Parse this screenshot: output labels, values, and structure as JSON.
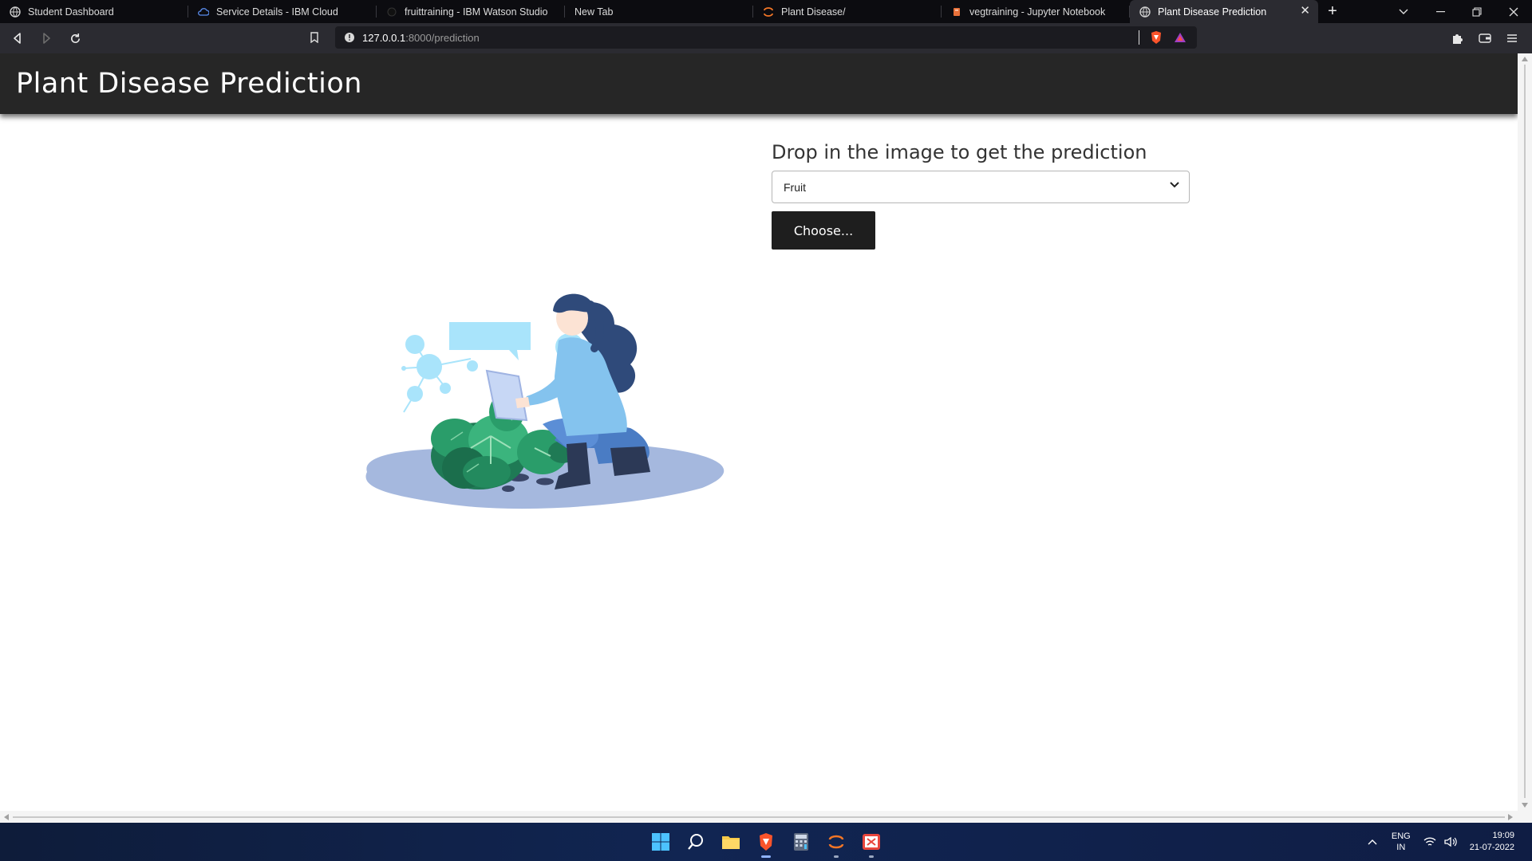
{
  "browser": {
    "tabs": [
      {
        "title": "Student Dashboard",
        "icon": "globe-icon",
        "active": false
      },
      {
        "title": "Service Details - IBM Cloud",
        "icon": "cloud-icon",
        "active": false
      },
      {
        "title": "fruittraining - IBM Watson Studio",
        "icon": "watson-icon",
        "active": false
      },
      {
        "title": "New Tab",
        "icon": "",
        "active": false
      },
      {
        "title": "Plant Disease/",
        "icon": "jupyter-icon",
        "active": false
      },
      {
        "title": "vegtraining - Jupyter Notebook",
        "icon": "notebook-icon",
        "active": false
      },
      {
        "title": "Plant Disease Prediction",
        "icon": "globe-icon",
        "active": true
      }
    ],
    "url_host": "127.0.0.1",
    "url_path": ":8000/prediction"
  },
  "page": {
    "title": "Plant Disease Prediction",
    "heading": "Drop in the image to get the prediction",
    "select_value": "Fruit",
    "choose_label": "Choose..."
  },
  "taskbar": {
    "lang_line1": "ENG",
    "lang_line2": "IN",
    "time": "19:09",
    "date": "21-07-2022"
  },
  "colors": {
    "header_bg": "#262626",
    "button_bg": "#1e1e1e",
    "accent_light_blue": "#a9e4fb",
    "leaf_green": "#2a9d6a"
  }
}
